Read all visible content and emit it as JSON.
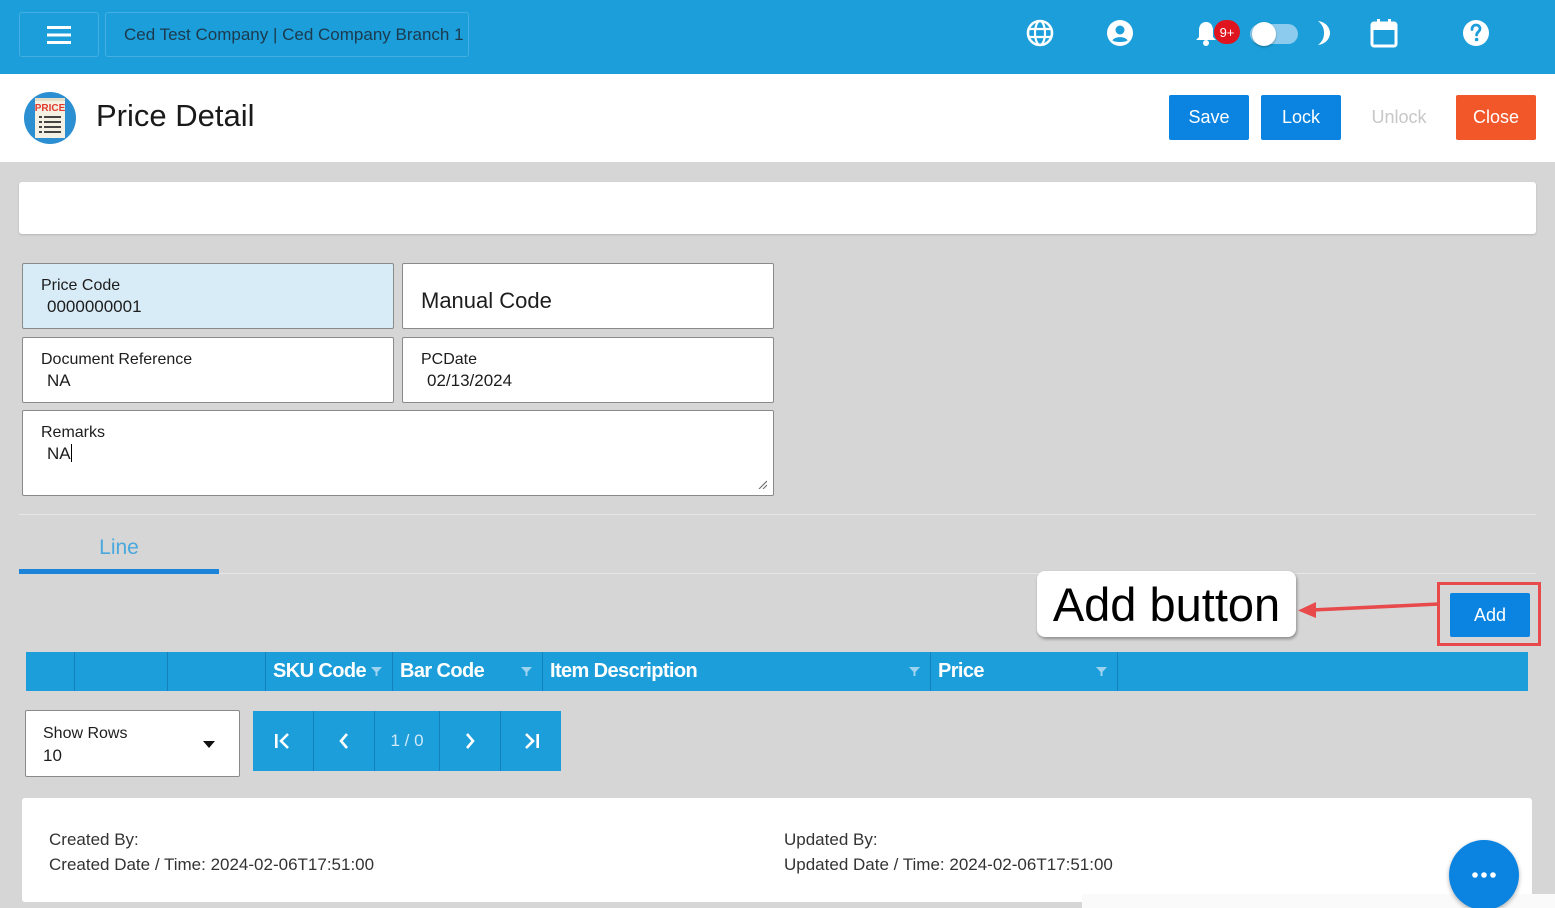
{
  "topbar": {
    "company_text": "Ced Test Company | Ced Company Branch 1",
    "notification_count": "9+",
    "icons": [
      "menu-icon",
      "globe-icon",
      "user-circle-icon",
      "bell-icon",
      "toggle-switch",
      "moon-icon",
      "calendar-icon",
      "help-icon"
    ]
  },
  "header": {
    "title": "Price Detail",
    "logo_text": "PRICE",
    "buttons": {
      "save": "Save",
      "lock": "Lock",
      "unlock": "Unlock",
      "close": "Close"
    }
  },
  "form": {
    "price_code": {
      "label": "Price Code",
      "value": "0000000001"
    },
    "manual_code": {
      "placeholder": "Manual Code"
    },
    "document_reference": {
      "label": "Document Reference",
      "value": "NA"
    },
    "pc_date": {
      "label": "PCDate",
      "value": "02/13/2024"
    },
    "remarks": {
      "label": "Remarks",
      "value": "NA"
    }
  },
  "tabs": [
    {
      "label": "Line",
      "active": true
    }
  ],
  "annotation": {
    "callout": "Add button",
    "color": "#e8494b"
  },
  "line_grid": {
    "add_label": "Add",
    "columns": [
      "",
      "",
      "",
      "SKU Code",
      "Bar Code",
      "Item Description",
      "Price",
      ""
    ]
  },
  "pager": {
    "show_rows_label": "Show Rows",
    "show_rows_value": "10",
    "page_info": "1 / 0"
  },
  "footer": {
    "created_by": "Created By:",
    "created_date": "Created Date / Time: 2024-02-06T17:51:00",
    "updated_by": "Updated By:",
    "updated_date": "Updated Date / Time: 2024-02-06T17:51:00"
  },
  "colors": {
    "primary": "#1b9ed9",
    "button_blue": "#0a84e0",
    "close_orange": "#f2572a",
    "badge_red": "#e0141e"
  }
}
